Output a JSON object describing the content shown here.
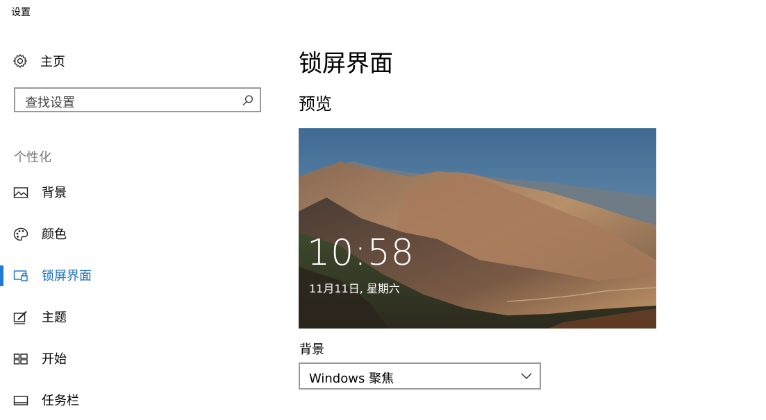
{
  "window": {
    "title": "设置"
  },
  "sidebar": {
    "home_label": "主页",
    "search_placeholder": "查找设置",
    "section_header": "个性化",
    "items": [
      {
        "label": "背景",
        "icon": "picture-icon",
        "active": false
      },
      {
        "label": "颜色",
        "icon": "palette-icon",
        "active": false
      },
      {
        "label": "锁屏界面",
        "icon": "lock-screen-icon",
        "active": true
      },
      {
        "label": "主题",
        "icon": "theme-pen-icon",
        "active": false
      },
      {
        "label": "开始",
        "icon": "start-grid-icon",
        "active": false
      },
      {
        "label": "任务栏",
        "icon": "taskbar-icon",
        "active": false
      }
    ]
  },
  "main": {
    "title": "锁屏界面",
    "preview_heading": "预览",
    "preview": {
      "time": "10:58",
      "date": "11月11日, 星期六"
    },
    "background_label": "背景",
    "background_value": "Windows 聚焦"
  },
  "colors": {
    "accent": "#1e7bd2",
    "active_text": "#1a6fc1"
  }
}
